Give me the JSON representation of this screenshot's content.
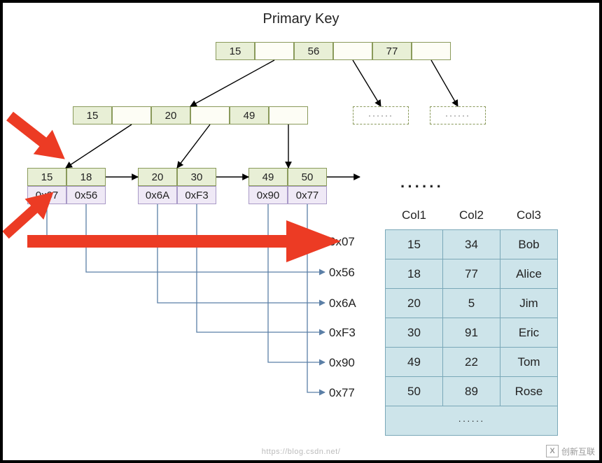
{
  "title": "Primary Key",
  "root": {
    "keys": [
      "15",
      "56",
      "77"
    ]
  },
  "internal": {
    "keys": [
      "15",
      "20",
      "49"
    ]
  },
  "leaves": [
    {
      "key1": "15",
      "key2": "18",
      "addr1": "0x07",
      "addr2": "0x56"
    },
    {
      "key1": "20",
      "key2": "30",
      "addr1": "0x6A",
      "addr2": "0xF3"
    },
    {
      "key1": "49",
      "key2": "50",
      "addr1": "0x90",
      "addr2": "0x77"
    }
  ],
  "ellipsis": "······",
  "addr_labels": [
    "0x07",
    "0x56",
    "0x6A",
    "0xF3",
    "0x90",
    "0x77"
  ],
  "dashed_ellipsis": "······",
  "table": {
    "headers": [
      "Col1",
      "Col2",
      "Col3"
    ],
    "rows": [
      [
        "15",
        "34",
        "Bob"
      ],
      [
        "18",
        "77",
        "Alice"
      ],
      [
        "20",
        "5",
        "Jim"
      ],
      [
        "30",
        "91",
        "Eric"
      ],
      [
        "49",
        "22",
        "Tom"
      ],
      [
        "50",
        "89",
        "Rose"
      ]
    ],
    "more": "······"
  },
  "watermark_brand": "创新互联",
  "watermark_url": "https://blog.csdn.net/"
}
